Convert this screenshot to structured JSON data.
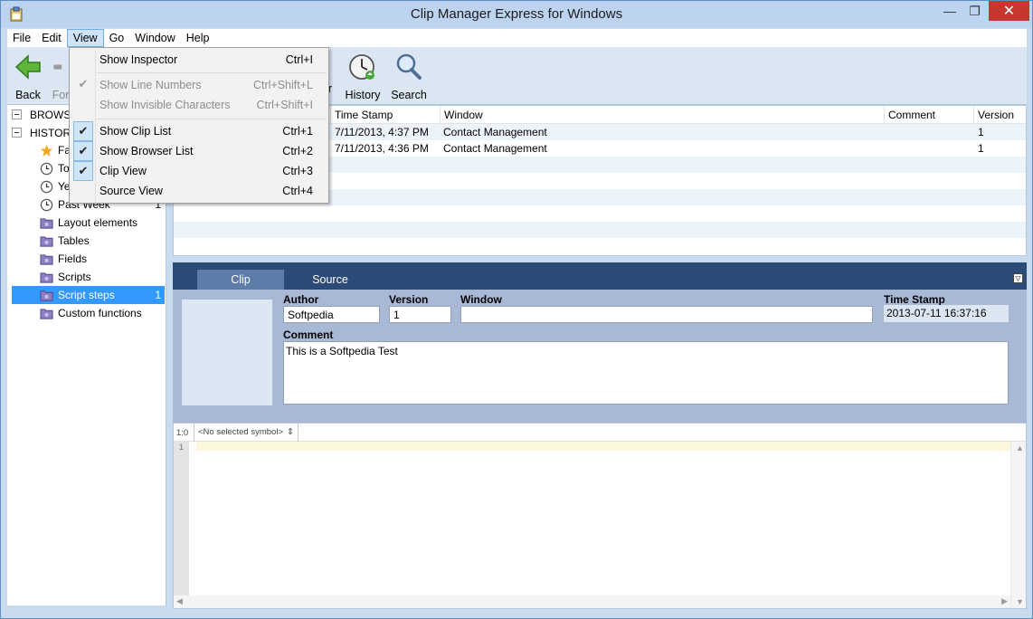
{
  "window": {
    "title": "Clip Manager Express for Windows",
    "close_glyph": "✕",
    "minimize_glyph": "—",
    "maximize_glyph": "❐"
  },
  "menubar": {
    "items": [
      "File",
      "Edit",
      "View",
      "Go",
      "Window",
      "Help"
    ]
  },
  "toolbar": {
    "back": "Back",
    "forward_partial": "For",
    "history": "History",
    "search": "Search",
    "hidden_partial": "r"
  },
  "view_menu": {
    "items": [
      {
        "label": "Show Inspector",
        "shortcut": "Ctrl+I",
        "checked": false,
        "enabled": true
      },
      {
        "label": "Show Line Numbers",
        "shortcut": "Ctrl+Shift+L",
        "checked": true,
        "enabled": false
      },
      {
        "label": "Show Invisible Characters",
        "shortcut": "Ctrl+Shift+I",
        "checked": false,
        "enabled": false
      },
      {
        "label": "Show Clip List",
        "shortcut": "Ctrl+1",
        "checked": true,
        "enabled": true
      },
      {
        "label": "Show Browser List",
        "shortcut": "Ctrl+2",
        "checked": true,
        "enabled": true
      },
      {
        "label": "Clip View",
        "shortcut": "Ctrl+3",
        "checked": true,
        "enabled": true
      },
      {
        "label": "Source View",
        "shortcut": "Ctrl+4",
        "checked": false,
        "enabled": true
      }
    ]
  },
  "tree": {
    "sections": [
      {
        "label": "BROWS"
      },
      {
        "label": "HISTORY"
      }
    ],
    "items": [
      {
        "label": "Fa",
        "icon": "star-icon",
        "count": ""
      },
      {
        "label": "To",
        "icon": "clock-icon",
        "count": ""
      },
      {
        "label": "Ye",
        "icon": "clock-icon",
        "count": ""
      },
      {
        "label": "Past Week",
        "icon": "clock-icon",
        "count": "1"
      },
      {
        "label": "Layout elements",
        "icon": "folder-icon",
        "count": ""
      },
      {
        "label": "Tables",
        "icon": "folder-icon",
        "count": ""
      },
      {
        "label": "Fields",
        "icon": "folder-icon",
        "count": ""
      },
      {
        "label": "Scripts",
        "icon": "folder-icon",
        "count": ""
      },
      {
        "label": "Script steps",
        "icon": "folder-icon",
        "count": "1",
        "selected": true
      },
      {
        "label": "Custom functions",
        "icon": "folder-icon",
        "count": ""
      }
    ]
  },
  "cliplist": {
    "columns": [
      "Time Stamp",
      "Window",
      "Comment",
      "Version"
    ],
    "rows": [
      {
        "timestamp": "7/11/2013, 4:37 PM",
        "window": "Contact Management",
        "comment": "",
        "version": "1"
      },
      {
        "timestamp": "7/11/2013, 4:36 PM",
        "window": "Contact Management",
        "comment": "",
        "version": "1"
      }
    ]
  },
  "detail": {
    "tabs": [
      "Clip",
      "Source"
    ],
    "collapse_glyph": "▽",
    "labels": {
      "author": "Author",
      "version": "Version",
      "window": "Window",
      "timestamp": "Time Stamp",
      "comment": "Comment"
    },
    "values": {
      "author": "Softpedia",
      "version": "1",
      "window": "",
      "timestamp": "2013-07-11 16:37:16",
      "comment": "This is a Softpedia Test"
    }
  },
  "editor": {
    "position": "1:0",
    "symbol": "<No selected symbol>",
    "symbol_arrows": "⇕",
    "line_number": "1"
  },
  "colors": {
    "accent": "#3399ff",
    "tab_bar": "#2c4a78",
    "inspector": "#a9b8d4",
    "close_button": "#c7372f"
  }
}
